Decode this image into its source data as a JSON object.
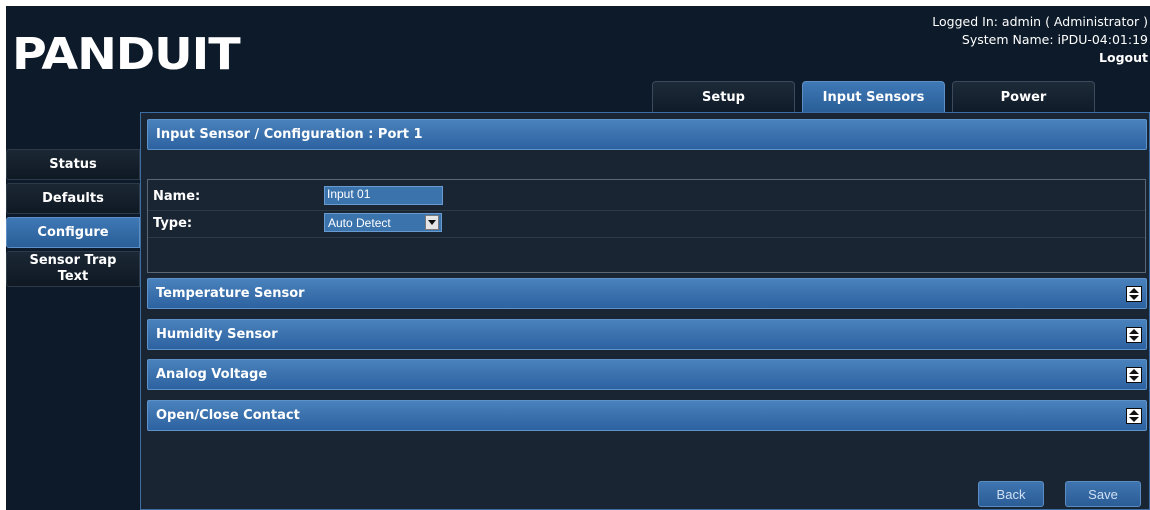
{
  "header": {
    "logo_text": "PANDUIT",
    "logged_in": "Logged In: admin ( Administrator )",
    "system_name": "System Name: iPDU-04:01:19",
    "logout_label": "Logout"
  },
  "tabs": [
    {
      "label": "Setup",
      "active": false
    },
    {
      "label": "Input Sensors",
      "active": true
    },
    {
      "label": "Power",
      "active": false
    }
  ],
  "sidebar": {
    "items": [
      {
        "label": "Status",
        "active": false
      },
      {
        "label": "Defaults",
        "active": false
      },
      {
        "label": "Configure",
        "active": true
      },
      {
        "label": "Sensor Trap Text",
        "active": false
      }
    ]
  },
  "main": {
    "title": "Input Sensor / Configuration : Port 1",
    "form": {
      "name_label": "Name:",
      "name_value": "Input 01",
      "type_label": "Type:",
      "type_value": "Auto Detect"
    },
    "sections": [
      {
        "label": "Temperature Sensor",
        "icon": "expand-collapse-icon"
      },
      {
        "label": "Humidity Sensor",
        "icon": "expand-collapse-icon"
      },
      {
        "label": "Analog Voltage",
        "icon": "expand-collapse-icon"
      },
      {
        "label": "Open/Close Contact",
        "icon": "expand-collapse-icon"
      }
    ],
    "back_label": "Back",
    "save_label": "Save"
  },
  "colors": {
    "background": "#0c1a29",
    "panel": "#1a2533",
    "accent": "#3a72b0",
    "text": "#ffffff"
  }
}
